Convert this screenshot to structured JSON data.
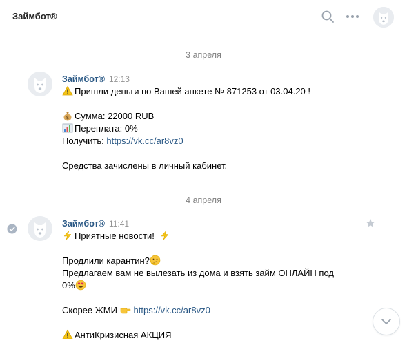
{
  "header": {
    "title": "Займбот®",
    "icons": [
      "search-icon",
      "more-icon"
    ],
    "avatar": "dog-avatar"
  },
  "dates": {
    "first": "3 апреля",
    "second": "4 апреля"
  },
  "messages": [
    {
      "author": "Займбот®",
      "time": "12:13",
      "lines": {
        "l1": "Пришли деньги по Вашей анкете № 871253 от 03.04.20 !",
        "l2": "Сумма: 22000 RUB",
        "l3": "Переплата: 0%",
        "l4_prefix": "Получить: ",
        "l4_link": "https://vk.cc/ar8vz0",
        "l5": "Средства зачислены в личный кабинет."
      }
    },
    {
      "author": "Займбот®",
      "time": "11:41",
      "lines": {
        "l1": "Приятные новости!",
        "l2": "Продлили карантин?",
        "l3": "Предлагаем вам не вылезать из дома и взять займ ОНЛАЙН под 0%",
        "l4_prefix": "Скорее ЖМИ ",
        "l4_link": "https://vk.cc/ar8vz0",
        "l5": "АнтиКризисная АКЦИЯ"
      }
    }
  ],
  "colors": {
    "author": "#2a5885",
    "link": "#2a5885",
    "meta": "#939393",
    "date": "#828282",
    "divider": "#e7e8ec"
  }
}
